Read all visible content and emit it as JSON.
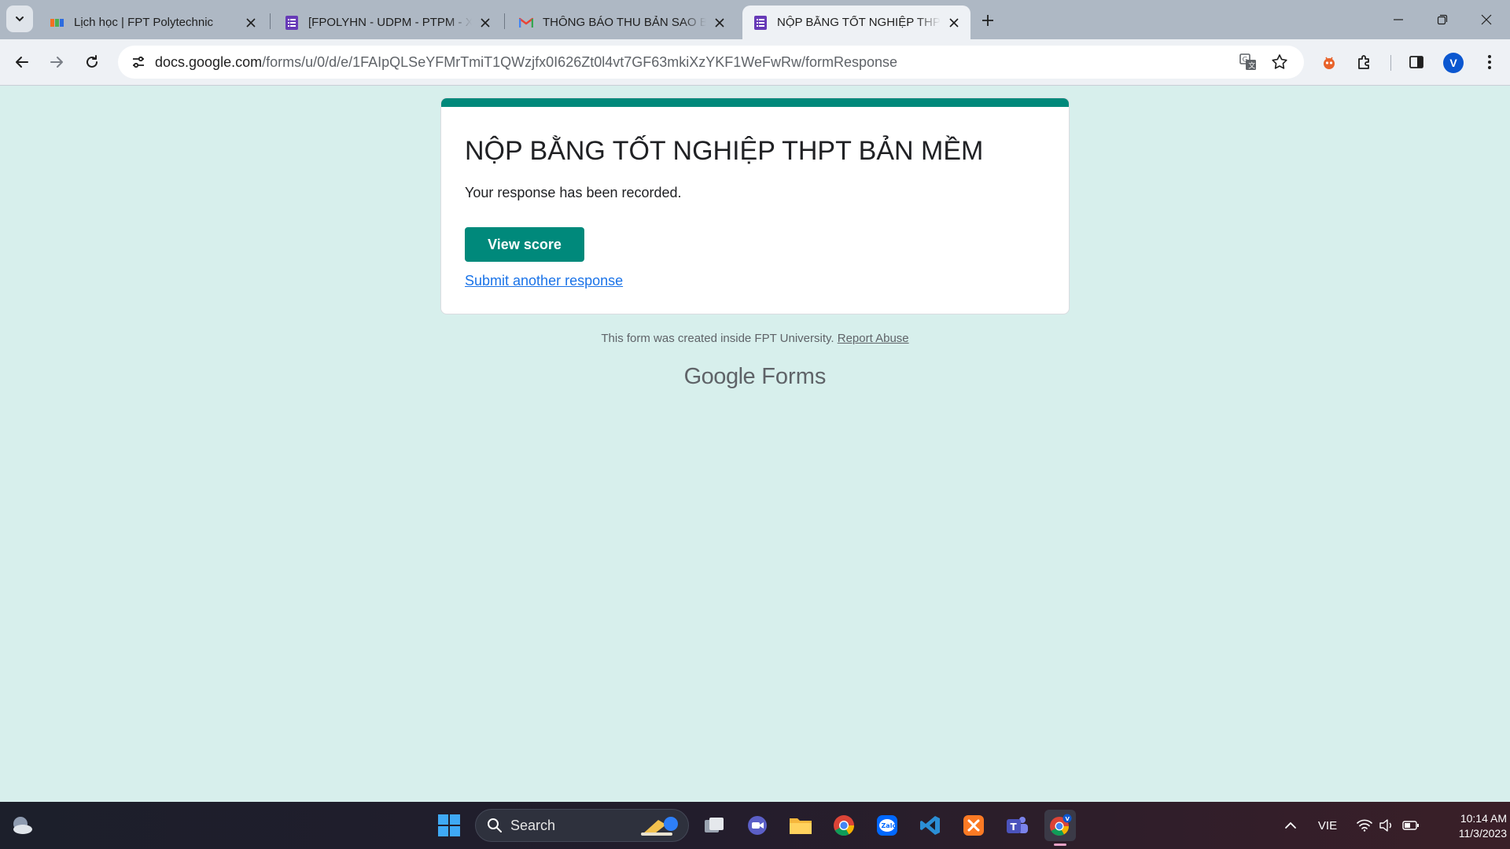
{
  "browser": {
    "tabs": [
      {
        "title": "Lịch học | FPT Polytechnic",
        "icon": "fpt-favicon"
      },
      {
        "title": "[FPOLYHN - UDPM - PTPM - X",
        "icon": "google-forms-favicon"
      },
      {
        "title": "THÔNG BÁO THU BẢN SAO BẰ",
        "icon": "gmail-favicon"
      },
      {
        "title": "NỘP BẰNG TỐT NGHIỆP THPT",
        "icon": "google-forms-favicon"
      }
    ],
    "active_tab": 3,
    "address": {
      "host": "docs.google.com",
      "path": "/forms/u/0/d/e/1FAIpQLSeYFMrTmiT1QWzjfx0I626Zt0l4vt7GF63mkiXzYKF1WeFwRw/formResponse"
    },
    "profile_initial": "V"
  },
  "form": {
    "title": "NỘP BẰNG TỐT NGHIỆP THPT BẢN MỀM",
    "message": "Your response has been recorded.",
    "view_score_label": "View score",
    "submit_another_label": "Submit another response",
    "accent_color": "#00897b"
  },
  "footer": {
    "note": "This form was created inside FPT University.",
    "report_abuse": "Report Abuse",
    "brand_google": "Google",
    "brand_forms": "Forms"
  },
  "taskbar": {
    "search_label": "Search",
    "language": "VIE",
    "time": "10:14 AM",
    "date": "11/3/2023"
  }
}
